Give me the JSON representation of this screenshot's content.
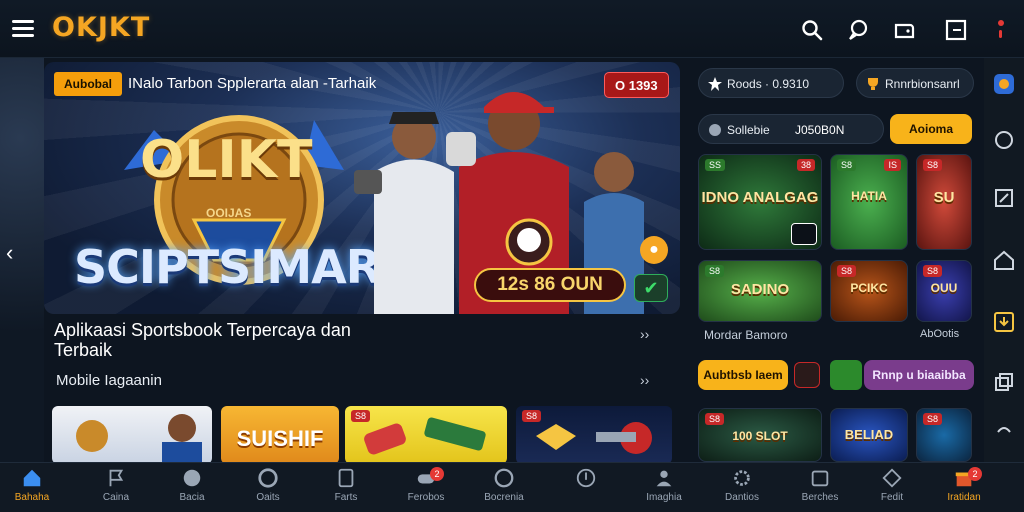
{
  "header": {
    "logo": "OKJKT"
  },
  "hero": {
    "badge": "Aubobal",
    "title": "INalo Tarbon Spplerarta alan -Tarhaik",
    "timer": "O 1393",
    "emblem_small": "OOIJAS",
    "emblem_big": "OLIKT",
    "brand_text": "SCIPTSIMAR",
    "prize": "12s 86 OUN",
    "caption": "Aplikaasi Sportsbook Terpercaya dan Terbaik",
    "sub": "Mobile Iagaanin",
    "arrows": "››"
  },
  "right": {
    "pill1": "Roods · 0.9310",
    "pill2": "Rnnrbionsanrl",
    "balance_label": "Sollebie",
    "balance_value": "J050B0N",
    "action_btn": "Aoioma",
    "games_row1": [
      {
        "tag": "SS",
        "hot": "38",
        "title": "IDNO ANALGAG"
      },
      {
        "tag": "S8",
        "hot": "IS",
        "title": "HATIA"
      },
      {
        "tag": "S8",
        "hot": "",
        "title": "SU"
      }
    ],
    "games_row2": [
      {
        "tag": "S8",
        "hot": "",
        "title": "SADINO"
      },
      {
        "tag": "S8",
        "hot": "",
        "title": "PCIKC"
      },
      {
        "tag": "S8",
        "hot": "",
        "title": "OUU"
      }
    ],
    "row2_label1": "Mordar Bamoro",
    "row2_label2": "AbOotis",
    "btn_left": "Aubtbsb Iaem",
    "btn_right": "Rnnp u biaaibba",
    "games_row3": [
      {
        "tag": "S8",
        "hot": "",
        "title": "100 SLOT"
      },
      {
        "tag": "",
        "hot": "",
        "title": "BELIAD"
      },
      {
        "tag": "S8",
        "hot": "",
        "title": ""
      }
    ]
  },
  "tiles": [
    {
      "name": "tile-players",
      "label": ""
    },
    {
      "name": "tile-sunshine",
      "label": "SUISHIF"
    },
    {
      "name": "tile-items",
      "label": "S8"
    },
    {
      "name": "tile-chest",
      "label": "S8"
    }
  ],
  "nav": [
    {
      "label": "Bahaha",
      "icon": "home-icon",
      "active": true
    },
    {
      "label": "Caina",
      "icon": "flag-icon"
    },
    {
      "label": "Bacia",
      "icon": "ball-icon"
    },
    {
      "label": "Oaits",
      "icon": "chip-icon"
    },
    {
      "label": "Farts",
      "icon": "card-icon"
    },
    {
      "label": "Ferobos",
      "icon": "controller-icon",
      "badge": "2"
    },
    {
      "label": "Bocrenia",
      "icon": "bell-icon"
    },
    {
      "label": "",
      "icon": "coin-icon"
    },
    {
      "label": "Imaghia",
      "icon": "user-icon"
    },
    {
      "label": "Dantios",
      "icon": "gear-icon"
    },
    {
      "label": "Berches",
      "icon": "calendar-icon"
    },
    {
      "label": "Fedit",
      "icon": "diamond-icon"
    },
    {
      "label": "Iratidan",
      "icon": "gift-icon",
      "badge": "2"
    }
  ],
  "colors": {
    "accent": "#f5a623",
    "bg": "#0d1520",
    "alert": "#e53935"
  }
}
